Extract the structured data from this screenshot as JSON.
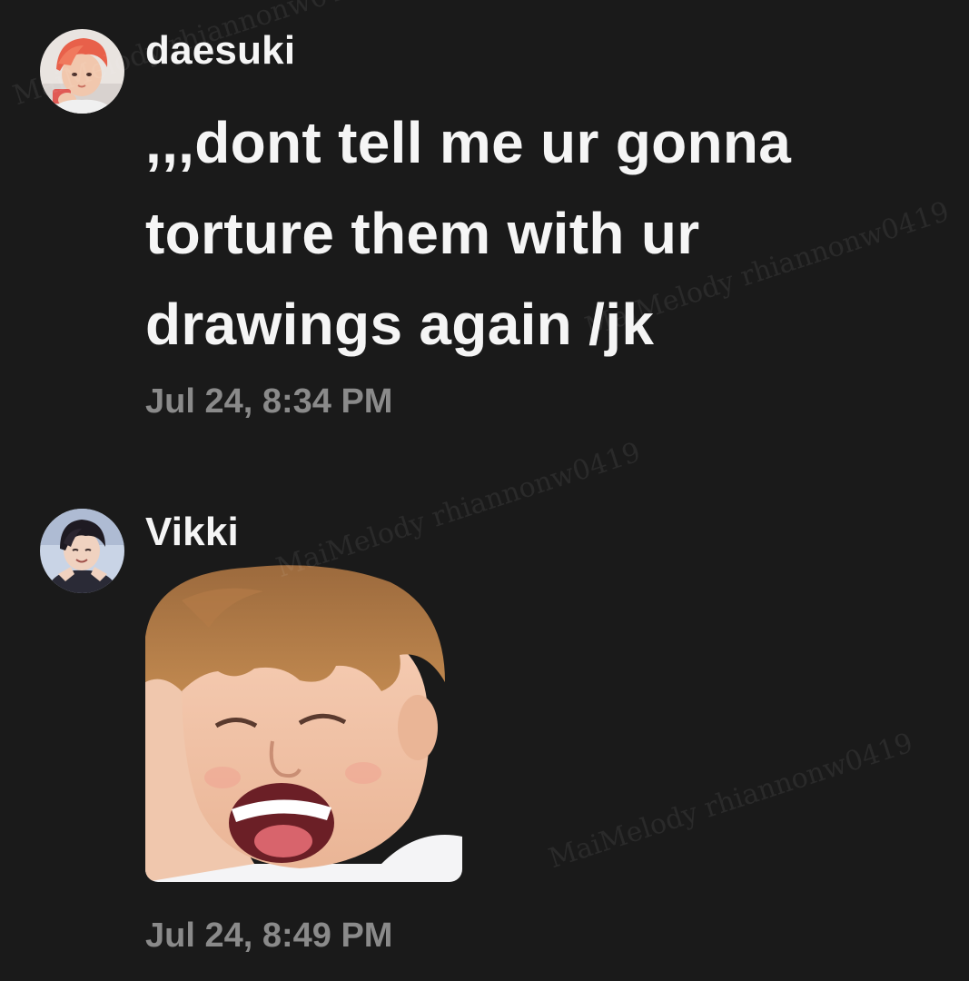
{
  "messages": [
    {
      "username": "daesuki",
      "text_lines": [
        ",,,dont tell me ur gonna",
        "torture them with ur",
        "drawings again /jk"
      ],
      "timestamp": "Jul 24, 8:34 PM",
      "avatar_icon": "avatar-daesuki"
    },
    {
      "username": "Vikki",
      "sticker_icon": "laughing-face-sticker",
      "timestamp": "Jul 24, 8:49 PM",
      "avatar_icon": "avatar-vikki"
    }
  ],
  "watermark": "MaiMelody rhiannonw0419",
  "colors": {
    "background": "#1a1a1a",
    "text": "#f5f5f5",
    "timestamp": "#8a8a8a"
  }
}
